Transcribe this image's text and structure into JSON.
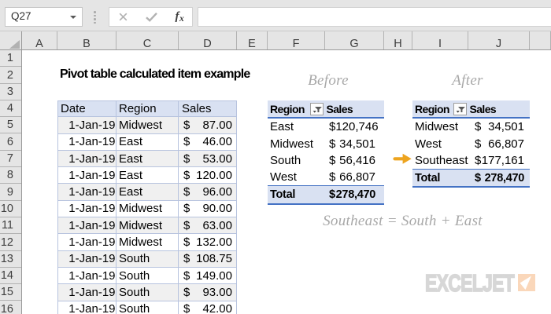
{
  "formula_bar": {
    "cell_reference": "Q27",
    "cancel_icon": "✕",
    "enter_icon": "✓",
    "fx_icon_f": "f",
    "fx_icon_x": "x",
    "formula_value": ""
  },
  "grid": {
    "column_letters": [
      "A",
      "B",
      "C",
      "D",
      "E",
      "F",
      "G",
      "H",
      "I",
      "J"
    ],
    "row_numbers": [
      "1",
      "2",
      "3",
      "4",
      "5",
      "6",
      "7",
      "8",
      "9",
      "10",
      "11",
      "12",
      "13",
      "14",
      "15",
      "16"
    ]
  },
  "title": "Pivot table calculated item example",
  "labels": {
    "before": "Before",
    "after": "After",
    "note": "Southeast = South + East"
  },
  "data_table": {
    "headers": [
      "Date",
      "Region",
      "Sales"
    ],
    "rows": [
      {
        "date": "1-Jan-19",
        "region": "Midwest",
        "currency": "$",
        "amount": "87.00"
      },
      {
        "date": "1-Jan-19",
        "region": "East",
        "currency": "$",
        "amount": "46.00"
      },
      {
        "date": "1-Jan-19",
        "region": "East",
        "currency": "$",
        "amount": "53.00"
      },
      {
        "date": "1-Jan-19",
        "region": "East",
        "currency": "$",
        "amount": "120.00"
      },
      {
        "date": "1-Jan-19",
        "region": "East",
        "currency": "$",
        "amount": "96.00"
      },
      {
        "date": "1-Jan-19",
        "region": "Midwest",
        "currency": "$",
        "amount": "90.00"
      },
      {
        "date": "1-Jan-19",
        "region": "Midwest",
        "currency": "$",
        "amount": "63.00"
      },
      {
        "date": "1-Jan-19",
        "region": "Midwest",
        "currency": "$",
        "amount": "132.00"
      },
      {
        "date": "1-Jan-19",
        "region": "South",
        "currency": "$",
        "amount": "108.75"
      },
      {
        "date": "1-Jan-19",
        "region": "South",
        "currency": "$",
        "amount": "149.00"
      },
      {
        "date": "1-Jan-19",
        "region": "South",
        "currency": "$",
        "amount": "93.00"
      },
      {
        "date": "1-Jan-19",
        "region": "South",
        "currency": "$",
        "amount": "42.00"
      }
    ]
  },
  "before_table": {
    "headers": [
      "Region",
      "Sales"
    ],
    "rows": [
      {
        "region": "East",
        "currency": "$",
        "amount": "120,746"
      },
      {
        "region": "Midwest",
        "currency": "$",
        "amount": "34,501"
      },
      {
        "region": "South",
        "currency": "$",
        "amount": "56,416"
      },
      {
        "region": "West",
        "currency": "$",
        "amount": "66,807"
      }
    ],
    "total": {
      "label": "Total",
      "currency": "$",
      "amount": "278,470"
    }
  },
  "after_table": {
    "headers": [
      "Region",
      "Sales"
    ],
    "rows": [
      {
        "region": "Midwest",
        "currency": "$",
        "amount": "34,501"
      },
      {
        "region": "West",
        "currency": "$",
        "amount": "66,807"
      },
      {
        "region": "Southeast",
        "currency": "$",
        "amount": "177,161"
      }
    ],
    "total": {
      "label": "Total",
      "currency": "$",
      "amount": "278,470"
    }
  },
  "logo": {
    "text": "EXCELJET"
  },
  "colors": {
    "bar_bg": "#e5e5e5",
    "table_header_fill": "#d9e1f2",
    "table_border": "#b7c3de",
    "pivot_border": "#4472c4",
    "band_fill": "#f0f0f0",
    "arrow_orange": "#eda41f",
    "logo_gray": "#d9d9d9",
    "logo_peach": "#fad7ba",
    "label_gray": "#a8a8a8"
  }
}
